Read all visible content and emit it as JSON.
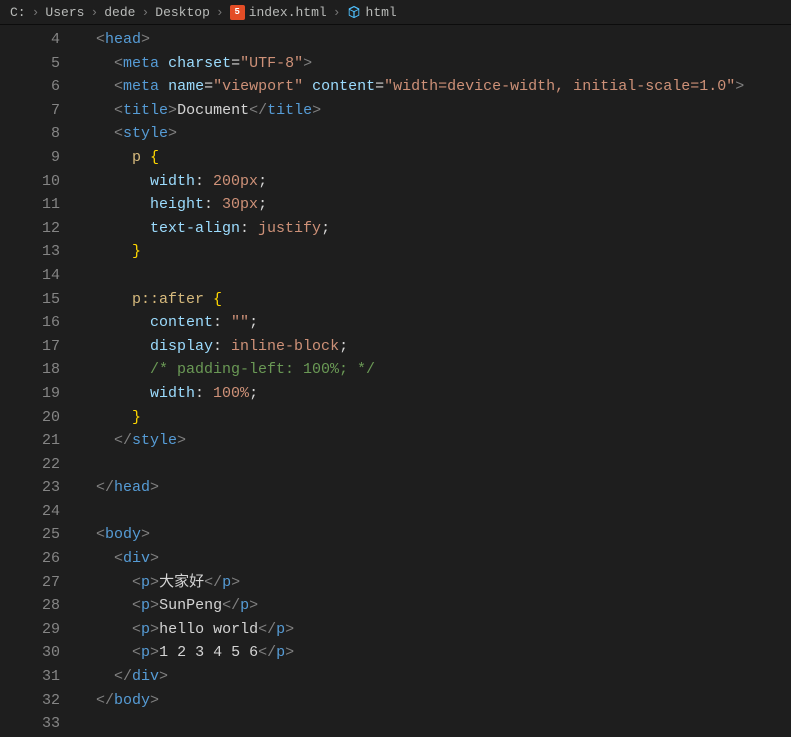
{
  "breadcrumbs": {
    "items": [
      {
        "label": "C:"
      },
      {
        "label": "Users"
      },
      {
        "label": "dede"
      },
      {
        "label": "Desktop"
      },
      {
        "label": "index.html",
        "icon": "html5"
      },
      {
        "label": "html",
        "icon": "cube"
      }
    ],
    "separator": "›"
  },
  "editor": {
    "first_line_number": 4,
    "last_line_number": 33,
    "lines": [
      {
        "n": 4,
        "indent": 1,
        "tokens": [
          [
            "br",
            "<"
          ],
          [
            "tag",
            "head"
          ],
          [
            "br",
            ">"
          ]
        ]
      },
      {
        "n": 5,
        "indent": 2,
        "tokens": [
          [
            "br",
            "<"
          ],
          [
            "tag",
            "meta"
          ],
          [
            "txt",
            " "
          ],
          [
            "attr",
            "charset"
          ],
          [
            "pun",
            "="
          ],
          [
            "str",
            "\"UTF-8\""
          ],
          [
            "br",
            ">"
          ]
        ]
      },
      {
        "n": 6,
        "indent": 2,
        "tokens": [
          [
            "br",
            "<"
          ],
          [
            "tag",
            "meta"
          ],
          [
            "txt",
            " "
          ],
          [
            "attr",
            "name"
          ],
          [
            "pun",
            "="
          ],
          [
            "str",
            "\"viewport\""
          ],
          [
            "txt",
            " "
          ],
          [
            "attr",
            "content"
          ],
          [
            "pun",
            "="
          ],
          [
            "str",
            "\"width=device-width, initial-scale=1.0\""
          ],
          [
            "br",
            ">"
          ]
        ]
      },
      {
        "n": 7,
        "indent": 2,
        "tokens": [
          [
            "br",
            "<"
          ],
          [
            "tag",
            "title"
          ],
          [
            "br",
            ">"
          ],
          [
            "txt",
            "Document"
          ],
          [
            "br",
            "</"
          ],
          [
            "tag",
            "title"
          ],
          [
            "br",
            ">"
          ]
        ]
      },
      {
        "n": 8,
        "indent": 2,
        "tokens": [
          [
            "br",
            "<"
          ],
          [
            "tag",
            "style"
          ],
          [
            "br",
            ">"
          ]
        ]
      },
      {
        "n": 9,
        "indent": 3,
        "tokens": [
          [
            "sel",
            "p "
          ],
          [
            "curly",
            "{"
          ]
        ]
      },
      {
        "n": 10,
        "indent": 4,
        "tokens": [
          [
            "prop",
            "width"
          ],
          [
            "pun",
            ": "
          ],
          [
            "val",
            "200px"
          ],
          [
            "pun",
            ";"
          ]
        ]
      },
      {
        "n": 11,
        "indent": 4,
        "tokens": [
          [
            "prop",
            "height"
          ],
          [
            "pun",
            ": "
          ],
          [
            "val",
            "30px"
          ],
          [
            "pun",
            ";"
          ]
        ]
      },
      {
        "n": 12,
        "indent": 4,
        "tokens": [
          [
            "prop",
            "text-align"
          ],
          [
            "pun",
            ": "
          ],
          [
            "val",
            "justify"
          ],
          [
            "pun",
            ";"
          ]
        ]
      },
      {
        "n": 13,
        "indent": 3,
        "tokens": [
          [
            "curly",
            "}"
          ]
        ]
      },
      {
        "n": 14,
        "indent": 0,
        "tokens": []
      },
      {
        "n": 15,
        "indent": 3,
        "tokens": [
          [
            "sel",
            "p::after "
          ],
          [
            "curly",
            "{"
          ]
        ]
      },
      {
        "n": 16,
        "indent": 4,
        "tokens": [
          [
            "prop",
            "content"
          ],
          [
            "pun",
            ": "
          ],
          [
            "str",
            "\"\""
          ],
          [
            "pun",
            ";"
          ]
        ]
      },
      {
        "n": 17,
        "indent": 4,
        "tokens": [
          [
            "prop",
            "display"
          ],
          [
            "pun",
            ": "
          ],
          [
            "val",
            "inline-block"
          ],
          [
            "pun",
            ";"
          ]
        ]
      },
      {
        "n": 18,
        "indent": 4,
        "tokens": [
          [
            "cmt",
            "/* padding-left: 100%; */"
          ]
        ]
      },
      {
        "n": 19,
        "indent": 4,
        "tokens": [
          [
            "prop",
            "width"
          ],
          [
            "pun",
            ": "
          ],
          [
            "val",
            "100%"
          ],
          [
            "pun",
            ";"
          ]
        ]
      },
      {
        "n": 20,
        "indent": 3,
        "tokens": [
          [
            "curly",
            "}"
          ]
        ]
      },
      {
        "n": 21,
        "indent": 2,
        "tokens": [
          [
            "br",
            "</"
          ],
          [
            "tag",
            "style"
          ],
          [
            "br",
            ">"
          ]
        ]
      },
      {
        "n": 22,
        "indent": 0,
        "tokens": []
      },
      {
        "n": 23,
        "indent": 1,
        "tokens": [
          [
            "br",
            "</"
          ],
          [
            "tag",
            "head"
          ],
          [
            "br",
            ">"
          ]
        ]
      },
      {
        "n": 24,
        "indent": 0,
        "tokens": []
      },
      {
        "n": 25,
        "indent": 1,
        "tokens": [
          [
            "br",
            "<"
          ],
          [
            "tag",
            "body"
          ],
          [
            "br",
            ">"
          ]
        ]
      },
      {
        "n": 26,
        "indent": 2,
        "tokens": [
          [
            "br",
            "<"
          ],
          [
            "tag",
            "div"
          ],
          [
            "br",
            ">"
          ]
        ]
      },
      {
        "n": 27,
        "indent": 3,
        "tokens": [
          [
            "br",
            "<"
          ],
          [
            "tag",
            "p"
          ],
          [
            "br",
            ">"
          ],
          [
            "txt",
            "大家好"
          ],
          [
            "br",
            "</"
          ],
          [
            "tag",
            "p"
          ],
          [
            "br",
            ">"
          ]
        ]
      },
      {
        "n": 28,
        "indent": 3,
        "tokens": [
          [
            "br",
            "<"
          ],
          [
            "tag",
            "p"
          ],
          [
            "br",
            ">"
          ],
          [
            "txt",
            "SunPeng"
          ],
          [
            "br",
            "</"
          ],
          [
            "tag",
            "p"
          ],
          [
            "br",
            ">"
          ]
        ]
      },
      {
        "n": 29,
        "indent": 3,
        "tokens": [
          [
            "br",
            "<"
          ],
          [
            "tag",
            "p"
          ],
          [
            "br",
            ">"
          ],
          [
            "txt",
            "hello world"
          ],
          [
            "br",
            "</"
          ],
          [
            "tag",
            "p"
          ],
          [
            "br",
            ">"
          ]
        ]
      },
      {
        "n": 30,
        "indent": 3,
        "tokens": [
          [
            "br",
            "<"
          ],
          [
            "tag",
            "p"
          ],
          [
            "br",
            ">"
          ],
          [
            "txt",
            "1 2 3 4 5 6"
          ],
          [
            "br",
            "</"
          ],
          [
            "tag",
            "p"
          ],
          [
            "br",
            ">"
          ]
        ]
      },
      {
        "n": 31,
        "indent": 2,
        "tokens": [
          [
            "br",
            "</"
          ],
          [
            "tag",
            "div"
          ],
          [
            "br",
            ">"
          ]
        ]
      },
      {
        "n": 32,
        "indent": 1,
        "tokens": [
          [
            "br",
            "</"
          ],
          [
            "tag",
            "body"
          ],
          [
            "br",
            ">"
          ]
        ]
      },
      {
        "n": 33,
        "indent": 0,
        "tokens": []
      }
    ]
  }
}
